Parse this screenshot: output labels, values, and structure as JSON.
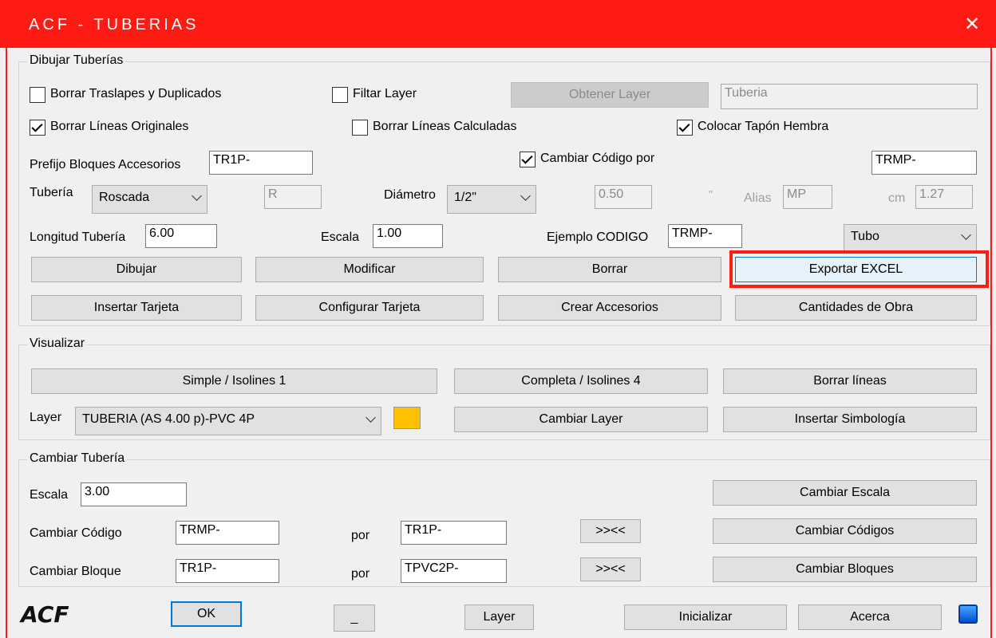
{
  "window": {
    "title": "ACF - TUBERIAS",
    "close_glyph": "✕"
  },
  "dibujar": {
    "legend": "Dibujar Tuberías",
    "borrar_traslapes": {
      "label": "Borrar Traslapes y Duplicados",
      "checked": false
    },
    "filtar_layer": {
      "label": "Filtar Layer",
      "checked": false
    },
    "obtener_layer_label": "Obtener Layer",
    "layer_value": "Tuberia",
    "borrar_originales": {
      "label": "Borrar Líneas Originales",
      "checked": true
    },
    "borrar_calculadas": {
      "label": "Borrar Líneas Calculadas",
      "checked": false
    },
    "colocar_tapon": {
      "label": "Colocar Tapón Hembra",
      "checked": true
    },
    "prefijo_label": "Prefijo Bloques Accesorios",
    "prefijo_value": "TR1P-",
    "cambiar_codigo": {
      "label": "Cambiar Código por",
      "checked": true
    },
    "cambiar_codigo_value": "TRMP-",
    "tuberia_label": "Tubería",
    "tuberia_selected": "Roscada",
    "tuberia_code": "R",
    "diametro_label": "Diámetro",
    "diametro_selected": "1/2\"",
    "diametro_value": "0.50",
    "inch_mark": "''",
    "alias_label": "Alias",
    "alias_value": "MP",
    "cm_label": "cm",
    "cm_value": "1.27",
    "longitud_label": "Longitud Tubería",
    "longitud_value": "6.00",
    "escala_label": "Escala",
    "escala_value": "1.00",
    "ejemplo_label": "Ejemplo CODIGO",
    "ejemplo_value": "TRMP-",
    "tipo_selected": "Tubo",
    "buttons": {
      "dibujar": "Dibujar",
      "modificar": "Modificar",
      "borrar": "Borrar",
      "exportar_excel": "Exportar EXCEL",
      "insertar_tarjeta": "Insertar Tarjeta",
      "configurar_tarjeta": "Configurar Tarjeta",
      "crear_accesorios": "Crear Accesorios",
      "cantidades_obra": "Cantidades de Obra"
    }
  },
  "visualizar": {
    "legend": "Visualizar",
    "buttons": {
      "simple": "Simple / Isolines 1",
      "completa": "Completa / Isolines 4",
      "borrar_lineas": "Borrar líneas",
      "cambiar_layer": "Cambiar Layer",
      "insertar_simbologia": "Insertar Simbología"
    },
    "layer_label": "Layer",
    "layer_selected": "TUBERIA (AS 4.00 p)-PVC 4P",
    "layer_color": "#ffc000"
  },
  "cambiar": {
    "legend": "Cambiar Tubería",
    "escala_label": "Escala",
    "escala_value": "3.00",
    "cambiar_codigo_label": "Cambiar Código",
    "codigo_from": "TRMP-",
    "codigo_por": "por",
    "codigo_to": "TR1P-",
    "cambiar_bloque_label": "Cambiar Bloque",
    "bloque_from": "TR1P-",
    "bloque_por": "por",
    "bloque_to": "TPVC2P-",
    "swap_label": ">><<",
    "buttons": {
      "cambiar_escala": "Cambiar Escala",
      "cambiar_codigos": "Cambiar Códigos",
      "cambiar_bloques": "Cambiar Bloques"
    }
  },
  "footer": {
    "logo_text": "ACF",
    "ok": "OK",
    "minimize": "_",
    "layer": "Layer",
    "inicializar": "Inicializar",
    "acerca": "Acerca"
  }
}
